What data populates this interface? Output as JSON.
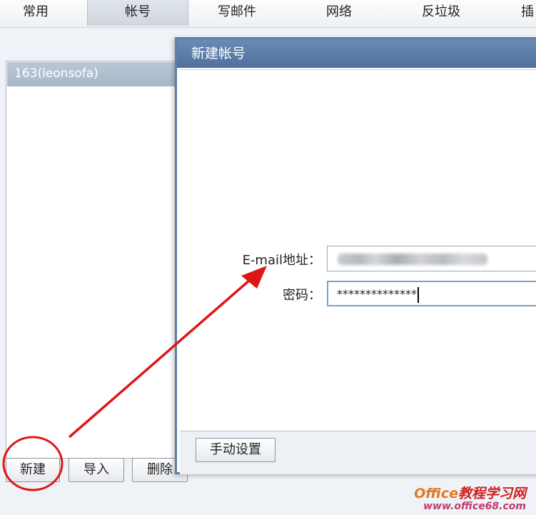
{
  "tabs": [
    {
      "label": "常用",
      "active": false
    },
    {
      "label": "帐号",
      "active": true
    },
    {
      "label": "写邮件",
      "active": false
    },
    {
      "label": "网络",
      "active": false
    },
    {
      "label": "反垃圾",
      "active": false
    },
    {
      "label": "插",
      "active": false
    }
  ],
  "accounts": {
    "items": [
      "163(leonsofa)"
    ]
  },
  "buttons": {
    "new_label": "新建",
    "import_label": "导入",
    "delete_label": "删除"
  },
  "dialog": {
    "title": "新建帐号",
    "email_label": "E-mail地址：",
    "password_label": "密码：",
    "password_value": "**************",
    "manual_settings_label": "手动设置"
  },
  "watermark": {
    "brand_prefix": "Office",
    "brand_suffix": "教程学习网",
    "site": "www.office68.com"
  },
  "colors": {
    "annotation_red": "#e01616",
    "dialog_title": "#5a7aa3"
  }
}
